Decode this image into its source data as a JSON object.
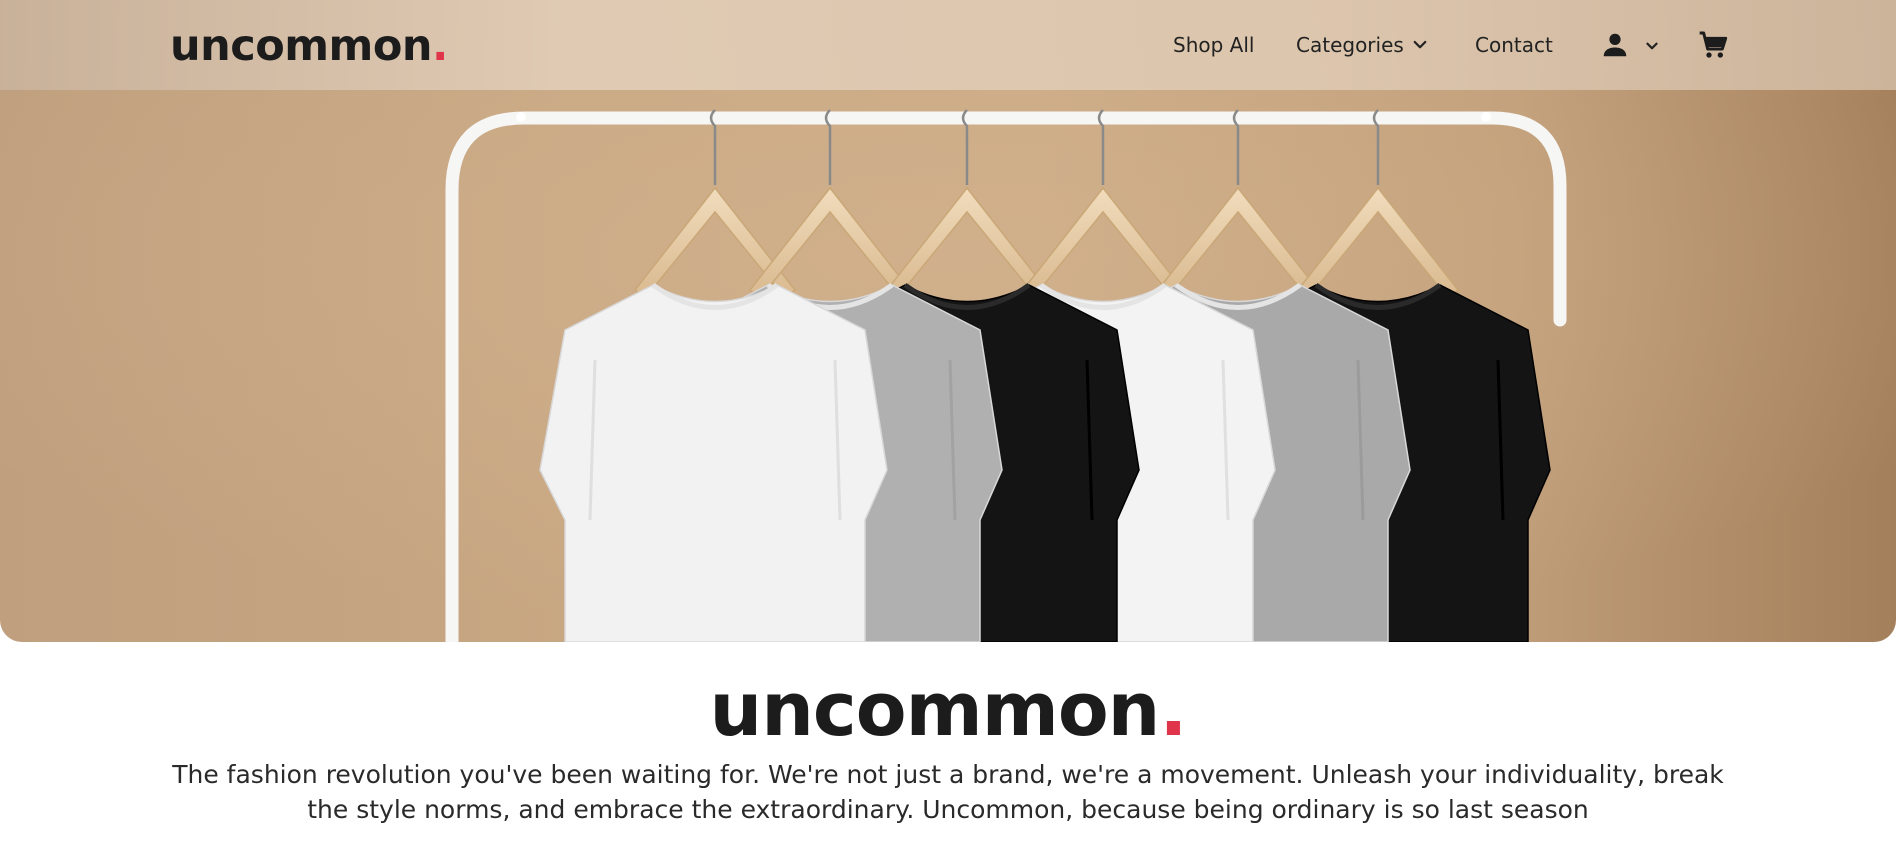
{
  "brand": {
    "name": "uncommon",
    "dot": ".",
    "accent_color": "#e0344a"
  },
  "nav": {
    "shop_all": "Shop All",
    "categories": "Categories",
    "contact": "Contact",
    "icons": [
      "chevron-down-icon",
      "user-icon",
      "cart-icon"
    ]
  },
  "hero": {
    "image": "six t-shirts on wooden hangers on a white clothing rack",
    "shirt_colors": [
      "#f2f2f2",
      "#b0b0b0",
      "#141414",
      "#f3f3f3",
      "#a9a9a9",
      "#141414"
    ],
    "background_color": "#c8a783"
  },
  "intro": {
    "title": "uncommon",
    "title_dot": ".",
    "text": "The fashion revolution you've been waiting for. We're not just a brand, we're a movement. Unleash your individuality, break the style norms, and embrace the extraordinary. Uncommon, because being ordinary is so last season"
  }
}
